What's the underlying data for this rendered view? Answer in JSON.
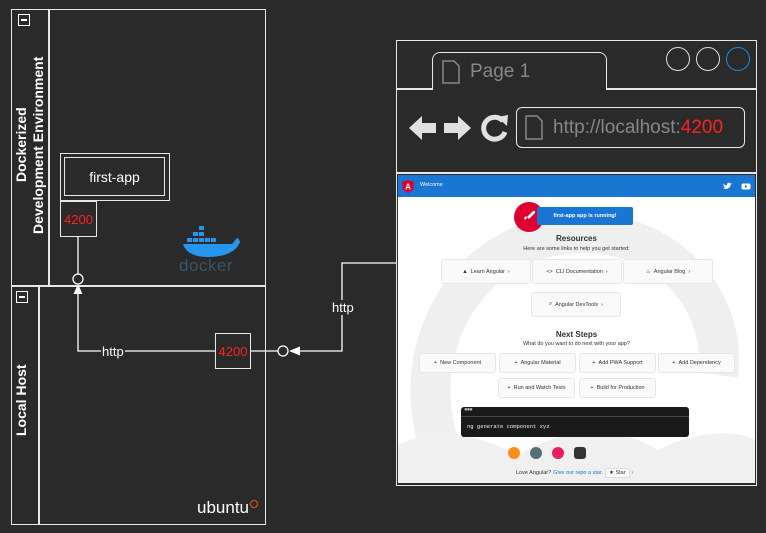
{
  "docker_env": {
    "label_line1": "Dockerized",
    "label_line2": "Development Environment",
    "logo_text": "docker"
  },
  "app": {
    "name": "first-app",
    "port": "4200"
  },
  "local_host": {
    "label": "Local Host",
    "os_logo": "ubuntu",
    "port": "4200"
  },
  "connections": {
    "http_inner": "http",
    "http_outer": "http"
  },
  "browser": {
    "tab_title": "Page 1",
    "url_prefix": "http://localhost:",
    "url_port": "4200"
  },
  "angular_page": {
    "header_title": "Welcome",
    "running_banner": "first-app app is running!",
    "resources_title": "Resources",
    "resources_sub": "Here are some links to help you get started:",
    "resource_links": [
      "Learn Angular",
      "CLI Documentation",
      "Angular Blog",
      "Angular DevTools"
    ],
    "next_steps_title": "Next Steps",
    "next_steps_sub": "What do you want to do next with your app?",
    "next_steps": [
      "New Component",
      "Angular Material",
      "Add PWA Support",
      "Add Dependency",
      "Run and Watch Tests",
      "Build for Production"
    ],
    "terminal_command": "ng generate component xyz",
    "footer_text": "Love Angular?",
    "footer_link": "Give our repo a star.",
    "star_button": "Star"
  },
  "colors": {
    "port_red": "#ff2020",
    "angular_blue": "#1976d2",
    "angular_red": "#dd0031",
    "browser_accent": "#1e88e5"
  }
}
